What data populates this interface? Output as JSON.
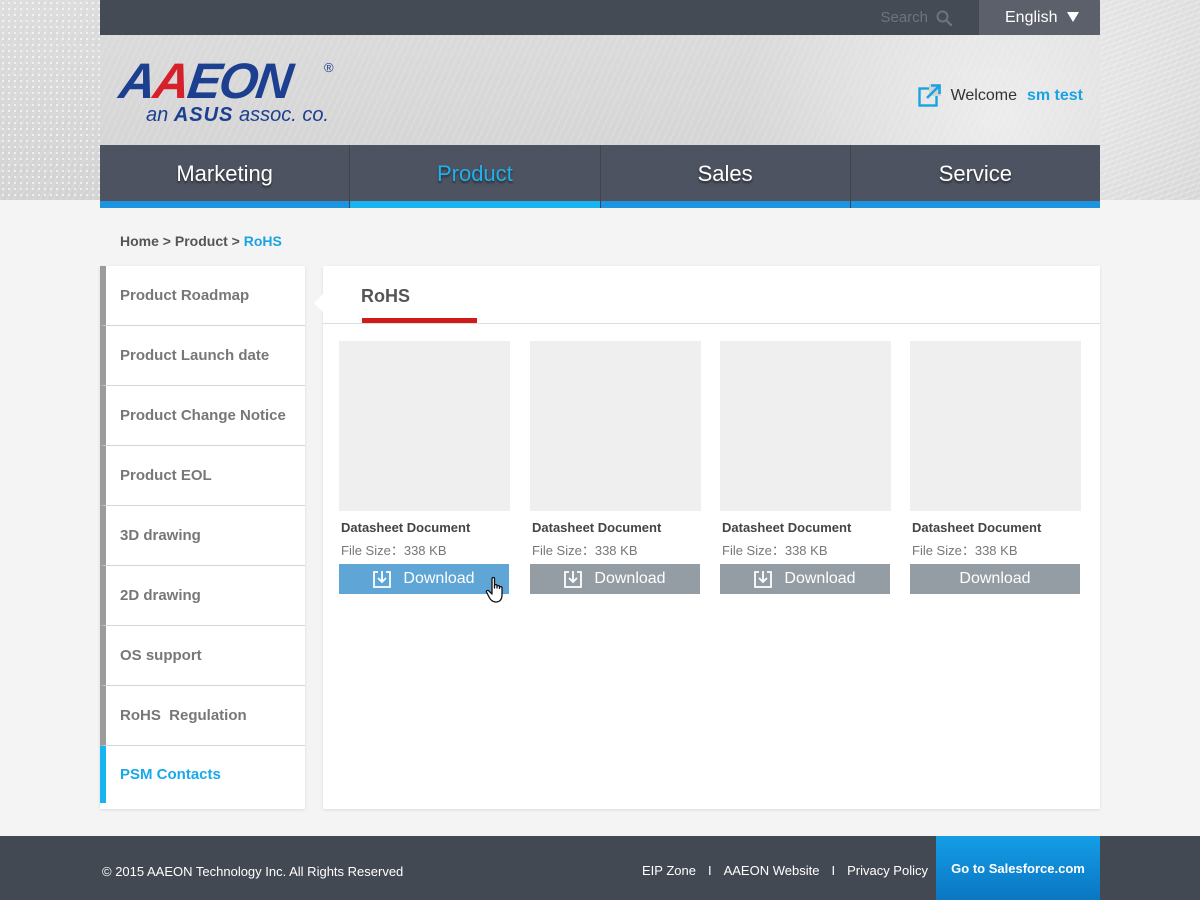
{
  "header": {
    "search_label": "Search",
    "language": "English",
    "logo": {
      "brand_part1": "A",
      "brand_part2": "A",
      "brand_part3": "EON",
      "registered": "®",
      "tagline_prefix": "an",
      "tagline_brand": "ASUS",
      "tagline_suffix": "assoc. co."
    },
    "welcome_label": "Welcome",
    "user_name": "sm test"
  },
  "nav": {
    "items": [
      {
        "label": "Marketing",
        "active": false
      },
      {
        "label": "Product",
        "active": true
      },
      {
        "label": "Sales",
        "active": false
      },
      {
        "label": "Service",
        "active": false
      }
    ]
  },
  "breadcrumb": {
    "home": "Home",
    "sep": ">",
    "product": "Product",
    "current": "RoHS"
  },
  "sidebar": {
    "items": [
      {
        "label": "Product Roadmap"
      },
      {
        "label": "Product Launch date"
      },
      {
        "label": "Product Change Notice"
      },
      {
        "label": "Product EOL"
      },
      {
        "label": "3D drawing"
      },
      {
        "label": "2D drawing"
      },
      {
        "label": "OS support"
      },
      {
        "label": "RoHS  Regulation"
      },
      {
        "label": "PSM Contacts"
      }
    ]
  },
  "panel": {
    "tab_label": "RoHS",
    "cards": [
      {
        "title": "Datasheet Document",
        "size_label": "File Size：338 KB",
        "button": "Download",
        "show_icon": true
      },
      {
        "title": "Datasheet Document",
        "size_label": "File Size：338 KB",
        "button": "Download",
        "show_icon": true
      },
      {
        "title": "Datasheet Document",
        "size_label": "File Size：338 KB",
        "button": "Download",
        "show_icon": true
      },
      {
        "title": "Datasheet Document",
        "size_label": "File Size：338 KB",
        "button": "Download",
        "show_icon": false
      }
    ]
  },
  "footer": {
    "copyright": "© 2015 AAEON Technology Inc. All Rights Reserved",
    "links": [
      "EIP Zone",
      "AAEON Website",
      "Privacy Policy"
    ],
    "link_sep": "I",
    "salesforce": "Go to Salesforce.com"
  },
  "colors": {
    "accent": "#19b3f2",
    "topbar": "#454b55",
    "nav": "#4d5360",
    "tab_underline": "#d11a1a",
    "button_gray": "#949ca4",
    "button_hover": "#5fa5d6",
    "footer": "#434953"
  },
  "icons": [
    "search-icon",
    "chevron-down-icon",
    "external-link-icon",
    "download-icon",
    "hand-cursor-icon"
  ]
}
